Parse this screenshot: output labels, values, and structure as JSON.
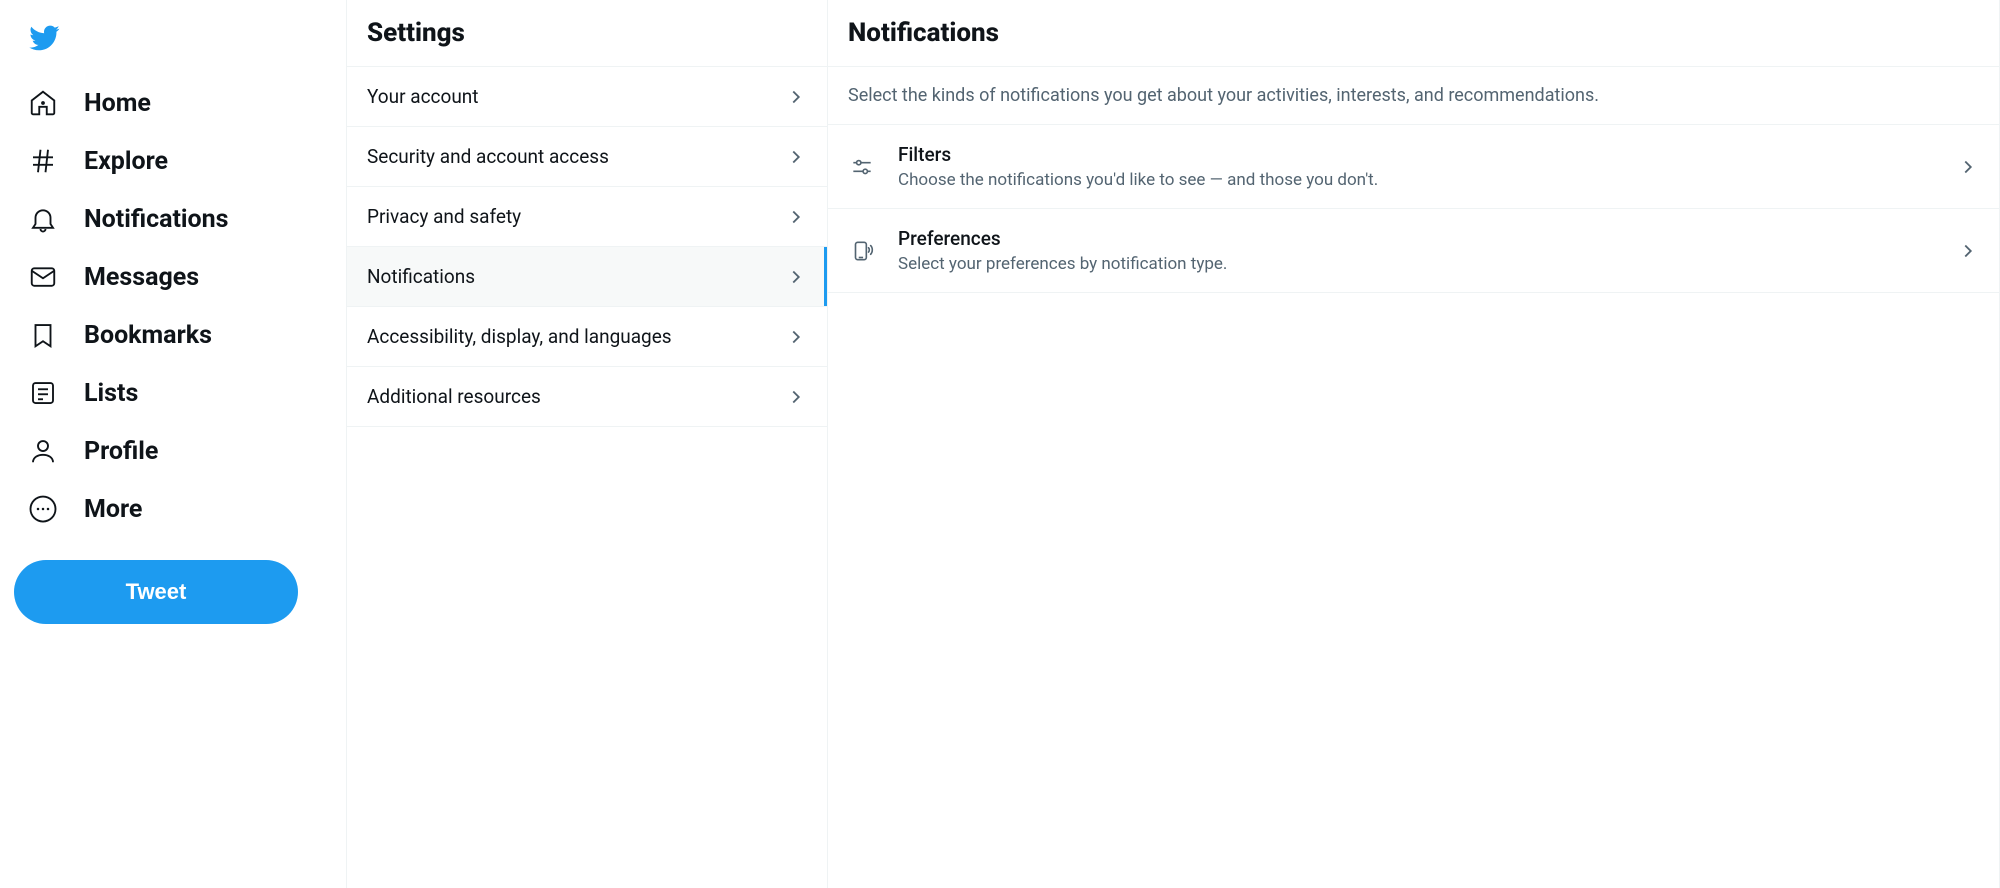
{
  "sidebar": {
    "items": [
      {
        "label": "Home",
        "icon": "home-icon"
      },
      {
        "label": "Explore",
        "icon": "hash-icon"
      },
      {
        "label": "Notifications",
        "icon": "bell-icon"
      },
      {
        "label": "Messages",
        "icon": "envelope-icon"
      },
      {
        "label": "Bookmarks",
        "icon": "bookmark-icon"
      },
      {
        "label": "Lists",
        "icon": "list-icon"
      },
      {
        "label": "Profile",
        "icon": "person-icon"
      },
      {
        "label": "More",
        "icon": "more-icon"
      }
    ],
    "tweet_label": "Tweet"
  },
  "settings": {
    "title": "Settings",
    "items": [
      {
        "label": "Your account"
      },
      {
        "label": "Security and account access"
      },
      {
        "label": "Privacy and safety"
      },
      {
        "label": "Notifications",
        "selected": true
      },
      {
        "label": "Accessibility, display, and languages"
      },
      {
        "label": "Additional resources"
      }
    ]
  },
  "detail": {
    "title": "Notifications",
    "description": "Select the kinds of notifications you get about your activities, interests, and recommendations.",
    "items": [
      {
        "title": "Filters",
        "subtitle": "Choose the notifications you'd like to see — and those you don't.",
        "icon": "filters-icon"
      },
      {
        "title": "Preferences",
        "subtitle": "Select your preferences by notification type.",
        "icon": "device-icon"
      }
    ]
  }
}
